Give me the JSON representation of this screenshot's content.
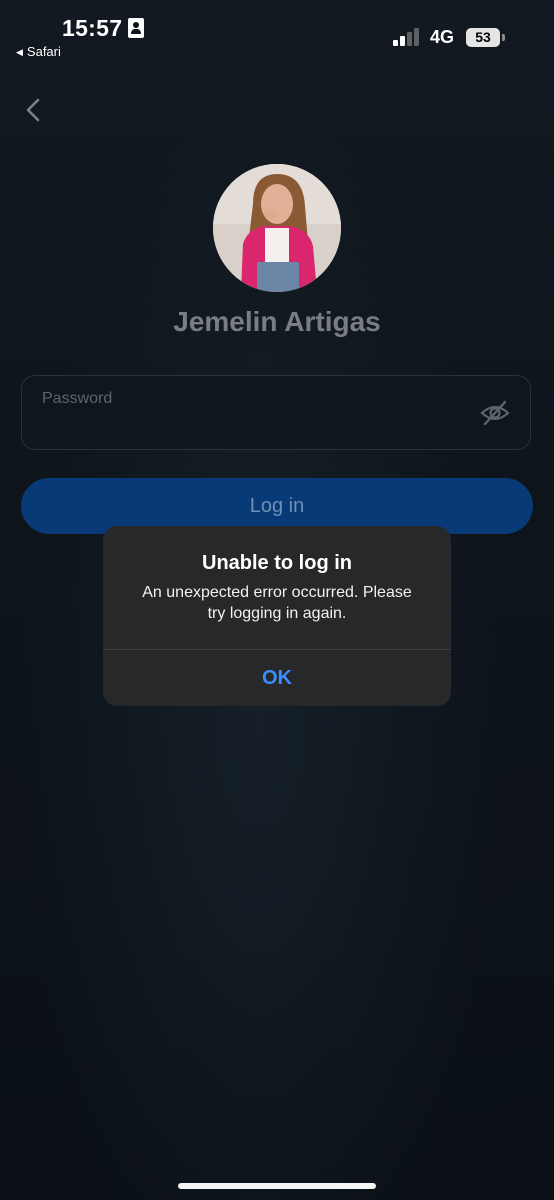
{
  "status_bar": {
    "time": "15:57",
    "back_app": "Safari",
    "network": "4G",
    "battery": "53"
  },
  "profile": {
    "name": "Jemelin Artigas"
  },
  "password_field": {
    "label": "Password"
  },
  "login_button": {
    "label": "Log in"
  },
  "dialog": {
    "title": "Unable to log in",
    "message_line1": "An unexpected error occurred. Please",
    "message_line2": "try logging in again.",
    "ok_label": "OK"
  },
  "colors": {
    "accent_button": "#083a78",
    "dialog_action": "#3a8dff",
    "background": "#0b1117"
  }
}
